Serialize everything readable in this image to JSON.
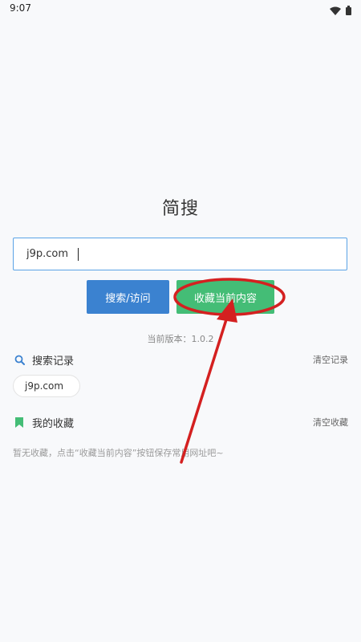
{
  "status_bar": {
    "time": "9:07",
    "icons": [
      "wifi-icon",
      "battery-icon"
    ]
  },
  "app": {
    "title": "简搜"
  },
  "search": {
    "value": "j9p.com"
  },
  "buttons": {
    "search_label": "搜索/访问",
    "favorite_label": "收藏当前内容"
  },
  "version_text": "当前版本：1.0.2",
  "history": {
    "title": "搜索记录",
    "clear_label": "清空记录",
    "items": [
      "j9p.com"
    ]
  },
  "favorites": {
    "title": "我的收藏",
    "clear_label": "清空收藏",
    "empty_text": "暂无收藏，点击“收藏当前内容”按钮保存常用网址吧~"
  },
  "colors": {
    "primary": "#3b82d0",
    "success": "#44bd76",
    "annotation": "#d42020"
  }
}
